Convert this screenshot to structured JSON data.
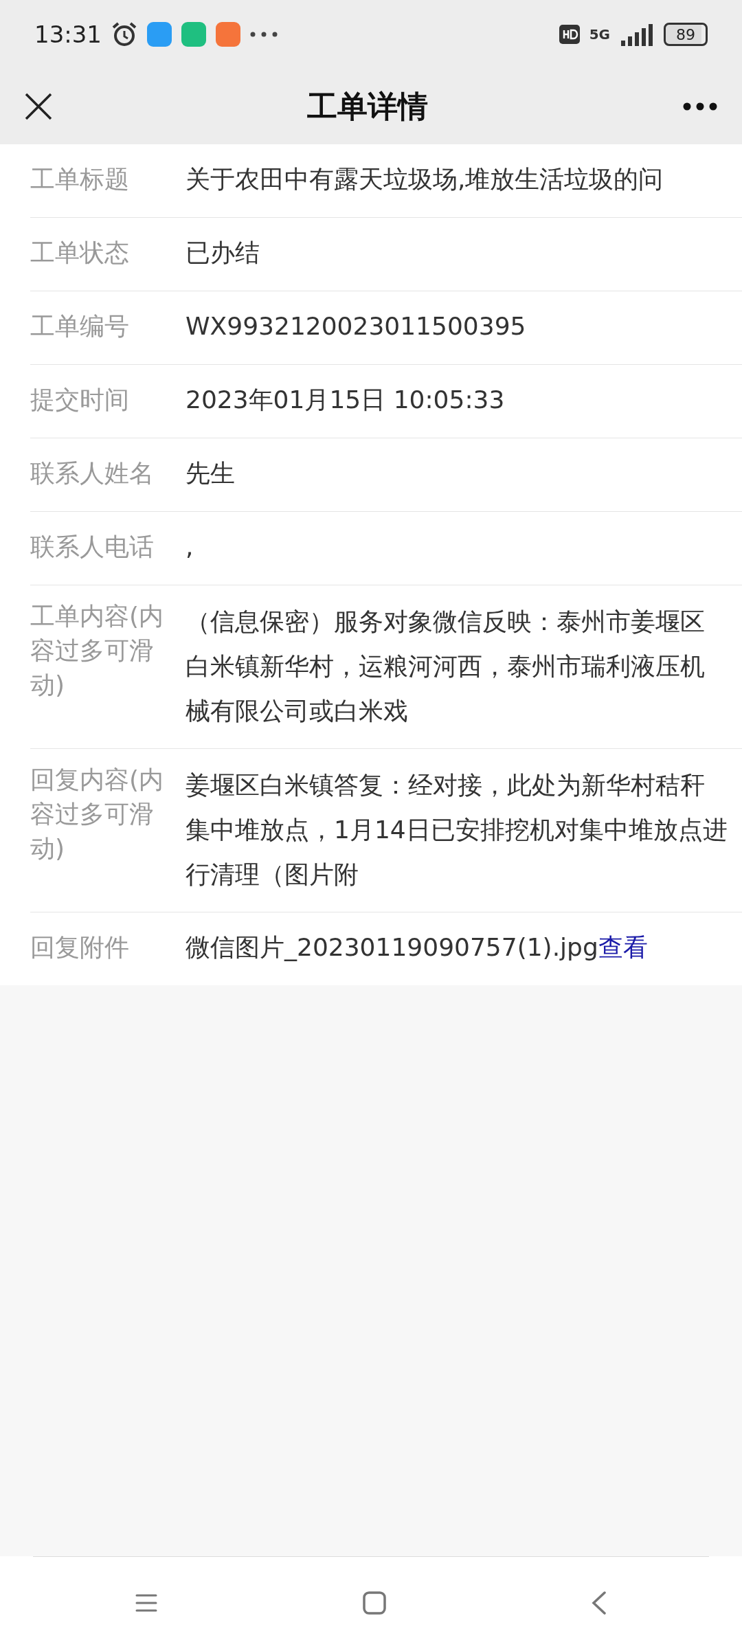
{
  "status_bar": {
    "time": "13:31",
    "network": "5G",
    "battery": "89"
  },
  "header": {
    "title": "工单详情"
  },
  "fields": [
    {
      "label": "工单标题",
      "value": "关于农田中有露天垃圾场,堆放生活垃圾的问"
    },
    {
      "label": "工单状态",
      "value": "已办结"
    },
    {
      "label": "工单编号",
      "value": "WX99321200230115003​95"
    },
    {
      "label": "提交时间",
      "value": "2023年01月15日  10:05:33"
    },
    {
      "label": "联系人姓名",
      "value": "先生"
    },
    {
      "label": "联系人电话",
      "value": ","
    },
    {
      "label": "工单内容(内容过多可滑动)",
      "value": "（信息保密）服务对象微信反映：泰州市姜堰区白米镇新华村，运粮河河西，泰州市瑞利液压机械有限公司或白米戏"
    },
    {
      "label": "回复内容(内容过多可滑动)",
      "value": "姜堰区白米镇答复：经对接，此处为新华村秸秆集中堆放点，1月14日已安排挖机对集中堆放点进行清理（图片附"
    },
    {
      "label": "回复附件",
      "value": "微信图片_20230119090757(1).jpg",
      "link": "查看"
    }
  ]
}
